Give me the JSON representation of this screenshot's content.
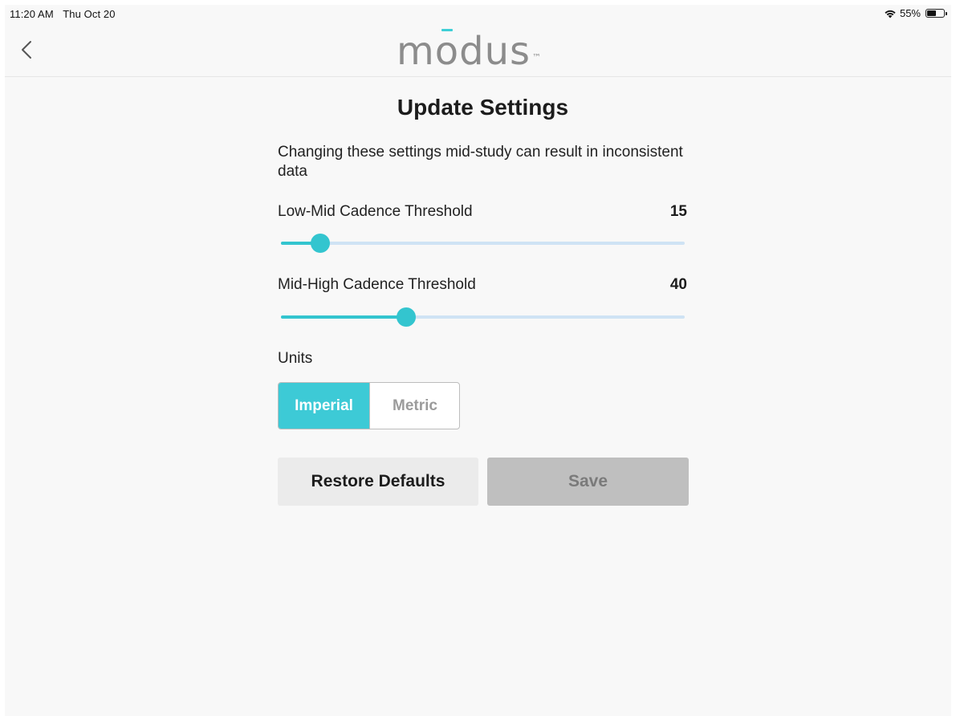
{
  "status_bar": {
    "time": "11:20 AM",
    "date": "Thu Oct 20",
    "battery": "55%",
    "battery_level": 0.55,
    "wifi_icon": "wifi-icon",
    "battery_icon": "battery-icon"
  },
  "nav": {
    "back_icon": "chevron-left-icon",
    "logo_pre": "m",
    "logo_o": "o",
    "logo_post": "dus",
    "logo_tm": "™"
  },
  "page": {
    "title": "Update Settings",
    "warning": "Changing these settings mid-study can result in inconsistent data"
  },
  "sliders": [
    {
      "label": "Low-Mid Cadence Threshold",
      "value": "15",
      "fraction": 0.097
    },
    {
      "label": "Mid-High Cadence Threshold",
      "value": "40",
      "fraction": 0.31
    }
  ],
  "units": {
    "label": "Units",
    "options": [
      "Imperial",
      "Metric"
    ],
    "selected": "Imperial"
  },
  "buttons": {
    "restore": "Restore Defaults",
    "save": "Save",
    "save_enabled": false
  },
  "colors": {
    "accent": "#33c5cf",
    "track": "#cfe3f4",
    "logo": "#8c8c8c",
    "save_disabled_bg": "#bfbfbf"
  }
}
